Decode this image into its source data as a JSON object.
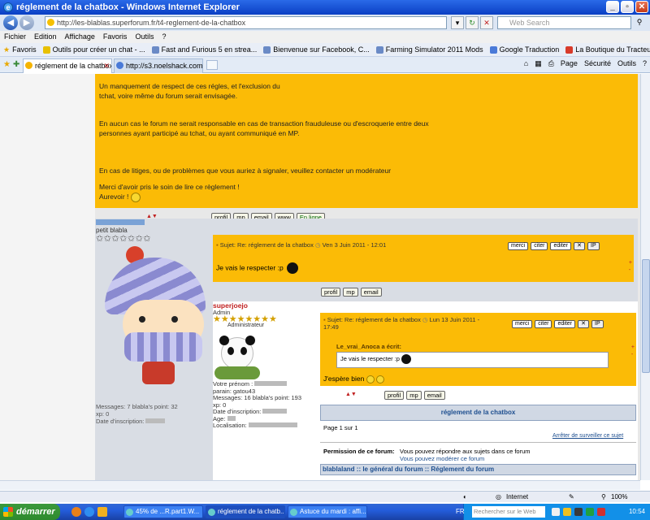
{
  "window": {
    "title": "réglement de la chatbox - Windows Internet Explorer"
  },
  "address": {
    "url": "http://les-blablas.superforum.fr/t4-reglement-de-la-chatbox",
    "search_placeholder": "Web Search"
  },
  "menu": [
    "Fichier",
    "Edition",
    "Affichage",
    "Favoris",
    "Outils",
    "?"
  ],
  "favorites": {
    "label": "Favoris",
    "items": [
      "Outils pour créer un chat - ...",
      "Fast and Furious 5 en strea...",
      "Bienvenue sur Facebook, C...",
      "Farming Simulator 2011 Mods",
      "Google Traduction",
      "La Boutique du Tracteur  Ve..."
    ]
  },
  "tabs": [
    {
      "label": "réglement de la chatbox"
    },
    {
      "label": "http://s3.noelshack.com/upl..."
    }
  ],
  "commandbar": [
    "Page",
    "Sécurité",
    "Outils"
  ],
  "rules": [
    "Un manquement de respect de ces régles, et l'exclusion du",
    "tchat, voire même du forum serait envisagée.",
    "En aucun cas le forum ne serait responsable en cas de transaction frauduleuse ou d'escroquerie entre deux",
    "personnes ayant participé au tchat, ou ayant communiqué en MP.",
    "En cas de litiges, ou de problèmes que vous auriez à signaler, veuillez contacter un modérateur",
    "Merci d'avoir pris le soin de lire ce règlement !",
    "Aurevoir !"
  ],
  "profile_buttons": [
    "profil",
    "mp",
    "email",
    "www",
    "En ligne"
  ],
  "post1": {
    "rank": "petit blabla",
    "subject": "Sujet: Re: réglement de la chatbox",
    "date": "Ven 3 Juin 2011 - 12:01",
    "message": "Je vais le respecter :p",
    "buttons": [
      "merci",
      "citer",
      "editer"
    ],
    "stats_messages": "Messages: 7",
    "stats_points": "blabla's point: 32",
    "stats_xp": "xp: 0",
    "stats_date": "Date d'inscription:"
  },
  "post1_footer_buttons": [
    "profil",
    "mp",
    "email"
  ],
  "post2": {
    "username": "superjoejo",
    "role": "Admin",
    "role_title": "Administrateur",
    "subject": "Sujet: Re: réglement de la chatbox",
    "date": "Lun 13 Juin 2011 - 17:49",
    "quote_author": "Le_vrai_Anoca a écrit:",
    "quote_text": "Je vais le respecter :p",
    "message": "J'espère bien",
    "buttons": [
      "merci",
      "citer",
      "editer"
    ],
    "info_firstname": "Votre prénom :",
    "info_parrain": "parain: gatou43",
    "info_messages": "Messages: 16",
    "info_points": "blabla's point: 193",
    "info_xp": "xp: 0",
    "info_date": "Date d'inscription:",
    "info_age": "Age:",
    "info_location": "Localisation:"
  },
  "post2_footer_buttons": [
    "profil",
    "mp",
    "email"
  ],
  "topic": {
    "title": "réglement de la chatbox",
    "pages": "Page 1 sur 1",
    "stop_watch": "Arrêter de surveiller ce sujet",
    "permission_label": "Permission de ce forum:",
    "permission_1": "Vous pouvez répondre aux sujets dans ce forum",
    "permission_2": "Vous pouvez modérer ce forum",
    "breadcrumb": "blablaland :: le général du forum :: Réglement du forum"
  },
  "status": {
    "zone": "Internet",
    "zoom": "100%"
  },
  "taskbar": {
    "start": "démarrer",
    "items": [
      "45% de ...R.part1.W...",
      "réglement de la chatb...",
      "Astuce du mardi : affi..."
    ],
    "lang": "FR",
    "search_placeholder": "Rechercher sur le Web",
    "time": "10:54"
  }
}
